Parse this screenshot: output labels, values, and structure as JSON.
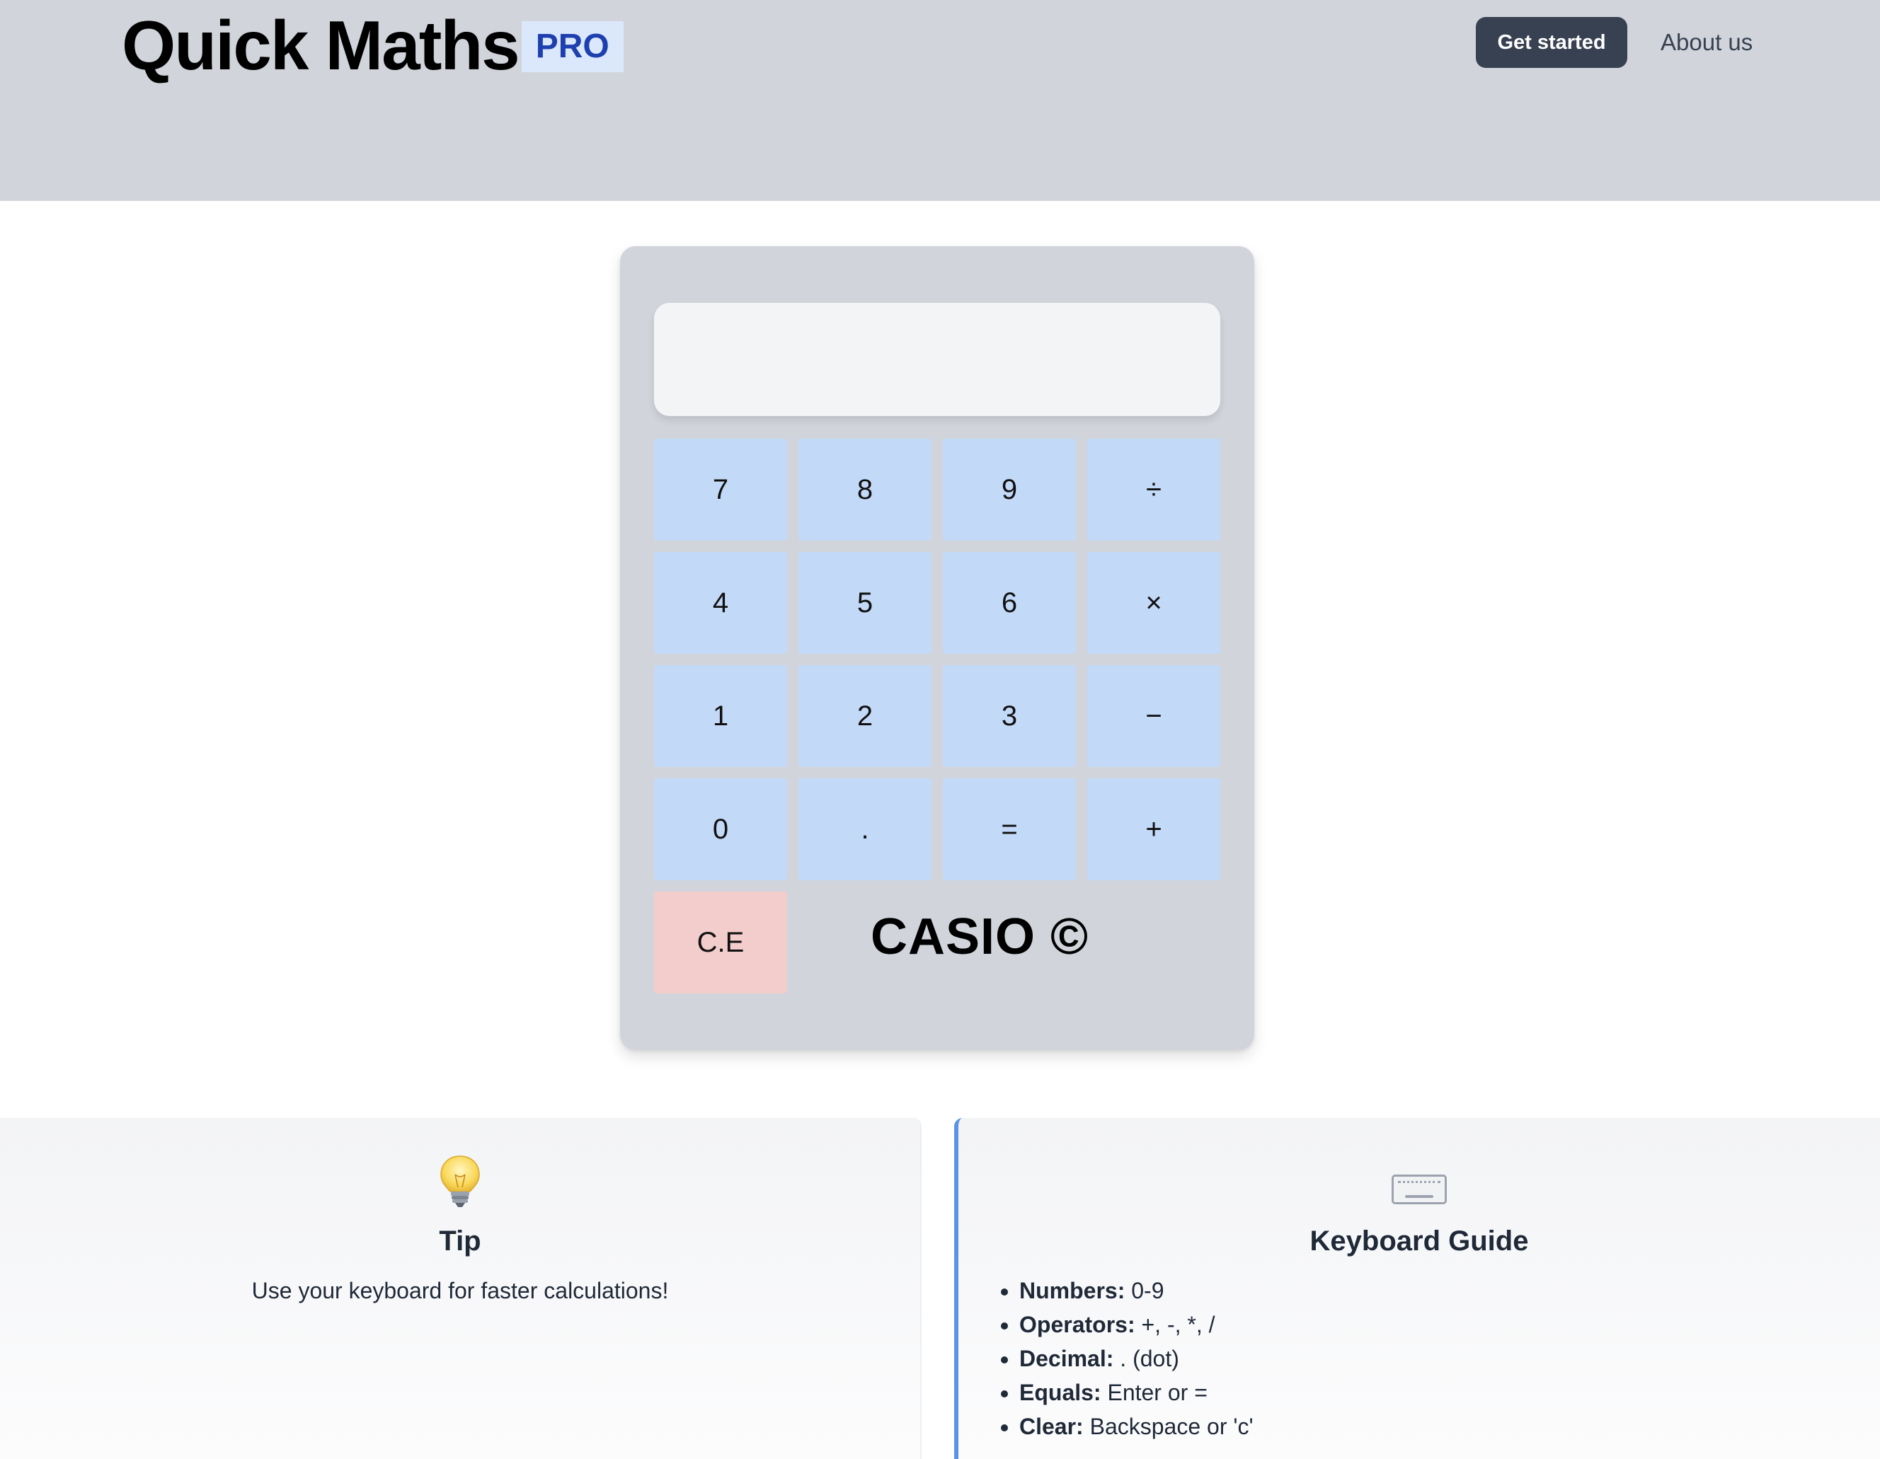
{
  "header": {
    "title": "Quick Maths",
    "badge": "PRO",
    "get_started_label": "Get started",
    "about_label": "About us"
  },
  "calculator": {
    "display_value": "",
    "keys": [
      {
        "label": "7",
        "name": "key-7",
        "type": "digit"
      },
      {
        "label": "8",
        "name": "key-8",
        "type": "digit"
      },
      {
        "label": "9",
        "name": "key-9",
        "type": "digit"
      },
      {
        "label": "÷",
        "name": "key-divide",
        "type": "operator"
      },
      {
        "label": "4",
        "name": "key-4",
        "type": "digit"
      },
      {
        "label": "5",
        "name": "key-5",
        "type": "digit"
      },
      {
        "label": "6",
        "name": "key-6",
        "type": "digit"
      },
      {
        "label": "×",
        "name": "key-multiply",
        "type": "operator"
      },
      {
        "label": "1",
        "name": "key-1",
        "type": "digit"
      },
      {
        "label": "2",
        "name": "key-2",
        "type": "digit"
      },
      {
        "label": "3",
        "name": "key-3",
        "type": "digit"
      },
      {
        "label": "−",
        "name": "key-subtract",
        "type": "operator"
      },
      {
        "label": "0",
        "name": "key-0",
        "type": "digit"
      },
      {
        "label": ".",
        "name": "key-decimal",
        "type": "digit"
      },
      {
        "label": "=",
        "name": "key-equals",
        "type": "operator"
      },
      {
        "label": "+",
        "name": "key-add",
        "type": "operator"
      }
    ],
    "clear_label": "C.E",
    "brand": "CASIO ©"
  },
  "tip_card": {
    "icon": "lightbulb-icon",
    "title": "Tip",
    "text": "Use your keyboard for faster calculations!"
  },
  "guide_card": {
    "icon": "keyboard-icon",
    "title": "Keyboard Guide",
    "items": [
      {
        "term": "Numbers:",
        "desc": " 0-9"
      },
      {
        "term": "Operators:",
        "desc": " +, -, *, /"
      },
      {
        "term": "Decimal:",
        "desc": " . (dot)"
      },
      {
        "term": "Equals:",
        "desc": " Enter or ="
      },
      {
        "term": "Clear:",
        "desc": " Backspace or 'c'"
      }
    ]
  },
  "colors": {
    "header_bg": "#d1d5db",
    "badge_bg": "#dbe7fb",
    "badge_text": "#1e40af",
    "button_bg": "#374151",
    "key_bg": "#c3d9f8",
    "clear_bg": "#f3cccc",
    "guide_accent": "#5b93e6"
  }
}
